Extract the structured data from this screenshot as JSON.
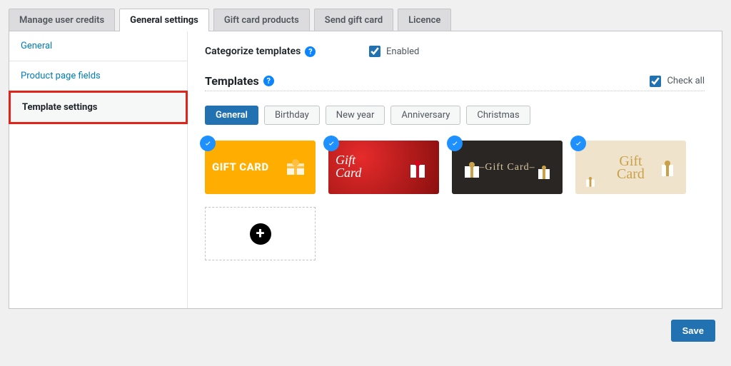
{
  "tabs": {
    "items": [
      {
        "label": "Manage user credits"
      },
      {
        "label": "General settings"
      },
      {
        "label": "Gift card products"
      },
      {
        "label": "Send gift card"
      },
      {
        "label": "Licence"
      }
    ],
    "active_index": 1
  },
  "sidebar": {
    "items": [
      {
        "label": "General"
      },
      {
        "label": "Product page fields"
      },
      {
        "label": "Template settings"
      }
    ],
    "active_index": 2
  },
  "categorize": {
    "label": "Categorize templates",
    "help": "?",
    "enabled_label": "Enabled",
    "enabled": true
  },
  "templates_section": {
    "title": "Templates",
    "help": "?",
    "checkall_label": "Check all",
    "checkall": true
  },
  "categories": {
    "items": [
      {
        "label": "General"
      },
      {
        "label": "Birthday"
      },
      {
        "label": "New year"
      },
      {
        "label": "Anniversary"
      },
      {
        "label": "Christmas"
      }
    ],
    "active_index": 0
  },
  "cards": [
    {
      "selected": true,
      "text": "GIFT CARD",
      "style": "c1"
    },
    {
      "selected": true,
      "text": "Gift\nCard",
      "style": "c2"
    },
    {
      "selected": true,
      "text": "–Gift Card–",
      "style": "c3"
    },
    {
      "selected": true,
      "text": "Gift\nCard",
      "style": "c4"
    }
  ],
  "add_template": {
    "icon": "+"
  },
  "footer": {
    "save_label": "Save"
  }
}
